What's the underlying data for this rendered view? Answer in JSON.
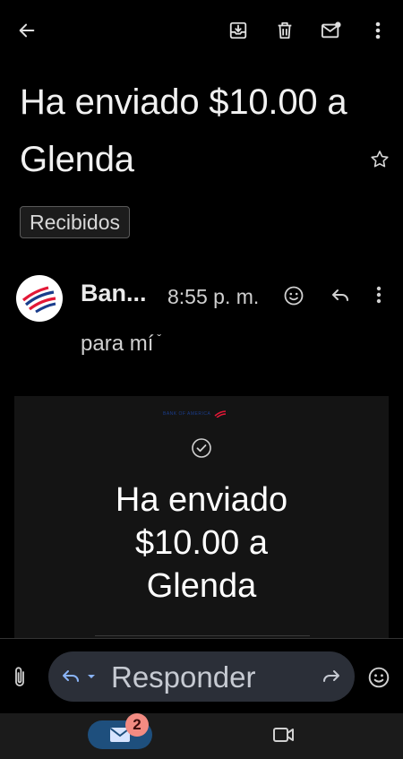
{
  "email": {
    "subject": "Ha enviado $10.00 a Glenda",
    "label": "Recibidos",
    "sender": "Ban...",
    "time": "8:55 p. m.",
    "recipient": "para mí",
    "body": {
      "logo_text": "BANK OF AMERICA",
      "headline": "Ha enviado $10.00 a Glenda"
    }
  },
  "toolbar": {
    "icons": [
      "back-arrow-icon",
      "archive-icon",
      "delete-icon",
      "mark-unread-icon",
      "more-vert-icon"
    ]
  },
  "reply": {
    "placeholder": "Responder"
  },
  "nav": {
    "mail_badge": "2"
  },
  "colors": {
    "background": "#000000",
    "reply_pill": "#2b2f38",
    "nav_active": "#1e4f7d",
    "badge": "#f28b82",
    "logo_red": "#e31837",
    "logo_blue": "#1a3d8c"
  }
}
